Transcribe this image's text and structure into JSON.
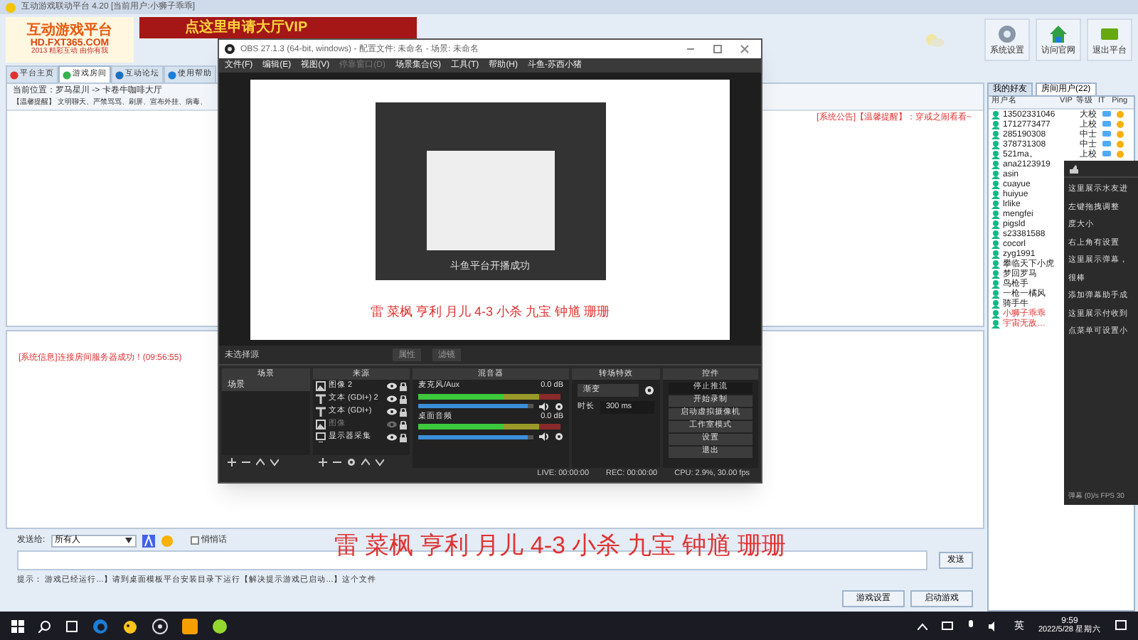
{
  "main_window": {
    "title": "互动游戏联动平台 4.20 [当前用户:小狮子乖乖]",
    "logo": {
      "name": "互动游戏平台",
      "url": "HD.FXT365.COM",
      "slogan": "2013 精彩互动 由你有我"
    },
    "banner": "点这里申请大厅VIP",
    "toolbar": [
      {
        "label": "系统设置",
        "kind": "gear"
      },
      {
        "label": "访问官网",
        "kind": "home"
      },
      {
        "label": "退出平台",
        "kind": "exit"
      }
    ],
    "tabs": [
      {
        "label": "平台主页",
        "selected": false
      },
      {
        "label": "游戏房间",
        "selected": true
      },
      {
        "label": "互动论坛",
        "selected": false
      },
      {
        "label": "使用帮助",
        "selected": false
      }
    ],
    "breadcrumb": "当前位置：罗马星川 -> 卡卷牛咖啡大厅",
    "notice": "【温馨提醒】 文明聊天、严禁骂骂、刷屏、宣布外挂、病毒、",
    "announcement": "[系统公告]【温馨提醒】：穿戒之闹看看~",
    "system_message": "[系统信息]连接房间服务器成功！(09:56:55)",
    "user_panel": {
      "tabs": [
        {
          "label": "我的好友",
          "selected": false
        },
        {
          "label": "房间用户(22)",
          "selected": true
        }
      ],
      "columns": [
        "用户名",
        "VIP",
        "等级",
        "IT",
        "Ping"
      ],
      "rows": [
        {
          "name": "13502331046",
          "rank": "大校",
          "highlight": false
        },
        {
          "name": "1712773477",
          "rank": "上校",
          "highlight": false
        },
        {
          "name": "285190308",
          "rank": "中士",
          "highlight": false
        },
        {
          "name": "378731308",
          "rank": "中士",
          "highlight": false
        },
        {
          "name": "521ma。",
          "rank": "上校",
          "highlight": false
        },
        {
          "name": "ana2123919",
          "highlight": false
        },
        {
          "name": "asin",
          "highlight": false
        },
        {
          "name": "cuayue",
          "highlight": false
        },
        {
          "name": "huiyue",
          "highlight": false
        },
        {
          "name": "lrlike",
          "highlight": false
        },
        {
          "name": "mengfei",
          "highlight": false
        },
        {
          "name": "pigsld",
          "highlight": false
        },
        {
          "name": "s23381588",
          "highlight": false
        },
        {
          "name": "cocorl",
          "highlight": false
        },
        {
          "name": "zyg1991",
          "highlight": false
        },
        {
          "name": "攀临天下小虎",
          "highlight": false
        },
        {
          "name": "梦回罗马",
          "highlight": false
        },
        {
          "name": "鸟枪手",
          "highlight": false
        },
        {
          "name": "一枪一橘风",
          "highlight": false
        },
        {
          "name": "骑手牛",
          "highlight": false
        },
        {
          "name": "小狮子乖乖",
          "highlight": true
        },
        {
          "name": "宇宙无敌…",
          "highlight": true
        }
      ]
    },
    "send_to_label": "发送给:",
    "send_to": "所有人",
    "whisper": {
      "label": "悄悄话",
      "checked": false
    },
    "send_button": "发送",
    "tip": "提示：   游戏已经运行…】请到桌面模板平台安装目录下运行【解决提示游戏已启动…】这个文件",
    "buttons": [
      "游戏设置",
      "启动游戏"
    ]
  },
  "overlay_caption": "雷 菜枫 亨利 月儿 4-3 小杀 九宝 钟馗 珊珊",
  "danmu_panel": {
    "items": [
      "这里展示水友进",
      "左键拖拽调整",
      "度大小",
      "右上角有设置",
      "这里展示弹幕，",
      "很棒",
      "添加弹幕助手成",
      "这里展示付收到",
      "点菜单可设置小"
    ],
    "footer": "弹幕 (0)/s FPS 30"
  },
  "obs": {
    "title": "OBS 27.1.3 (64-bit, windows) - 配置文件: 未命名 - 场景: 未命名",
    "menu": [
      {
        "label": "文件(F)",
        "disabled": false
      },
      {
        "label": "编辑(E)",
        "disabled": false
      },
      {
        "label": "视图(V)",
        "disabled": false
      },
      {
        "label": "停靠窗口(D)",
        "disabled": true
      },
      {
        "label": "场景集合(S)",
        "disabled": false
      },
      {
        "label": "工具(T)",
        "disabled": false
      },
      {
        "label": "帮助(H)",
        "disabled": false
      },
      {
        "label": "斗鱼-苏西小猪",
        "disabled": false
      }
    ],
    "preview": {
      "caption": "雷 菜枫 亨利 月儿 4-3 小杀 九宝 钟馗 珊珊",
      "toast": "斗鱼平台开播成功"
    },
    "no_source": "未选择源",
    "properties": "属性",
    "filters": "滤镜",
    "docks": {
      "scenes": "场景",
      "sources": "来源",
      "mixer": "混音器",
      "transitions": "转场特效",
      "controls": "控件"
    },
    "scenes": [
      {
        "label": "场景",
        "selected": true
      }
    ],
    "sources": [
      {
        "label": "图像 2",
        "kind": "image",
        "visible": true
      },
      {
        "label": "文本 (GDI+) 2",
        "kind": "text",
        "visible": true
      },
      {
        "label": "文本 (GDI+)",
        "kind": "text",
        "visible": true
      },
      {
        "label": "图像",
        "kind": "image",
        "visible": false
      },
      {
        "label": "显示器采集",
        "kind": "monitor",
        "visible": true
      }
    ],
    "mixer": [
      {
        "name": "麦克风/Aux",
        "reading": "0.0 dB",
        "level": 0.95
      },
      {
        "name": "桌面音频",
        "reading": "0.0 dB",
        "level": 0.95
      }
    ],
    "transition": {
      "value": "渐变",
      "duration_label": "时长",
      "duration": "300 ms"
    },
    "controls": [
      {
        "label": "停止推流",
        "active": true
      },
      {
        "label": "开始录制",
        "active": false
      },
      {
        "label": "启动虚拟摄像机",
        "active": false
      },
      {
        "label": "工作室模式",
        "active": false
      },
      {
        "label": "设置",
        "active": false
      },
      {
        "label": "退出",
        "active": false
      }
    ],
    "status": [
      "LIVE: 00:00:00",
      "REC: 00:00:00",
      "CPU: 2.9%, 30.00 fps"
    ]
  },
  "taskbar": {
    "ime": "英",
    "time": "9:59",
    "date": "2022/5/28 星期六"
  }
}
